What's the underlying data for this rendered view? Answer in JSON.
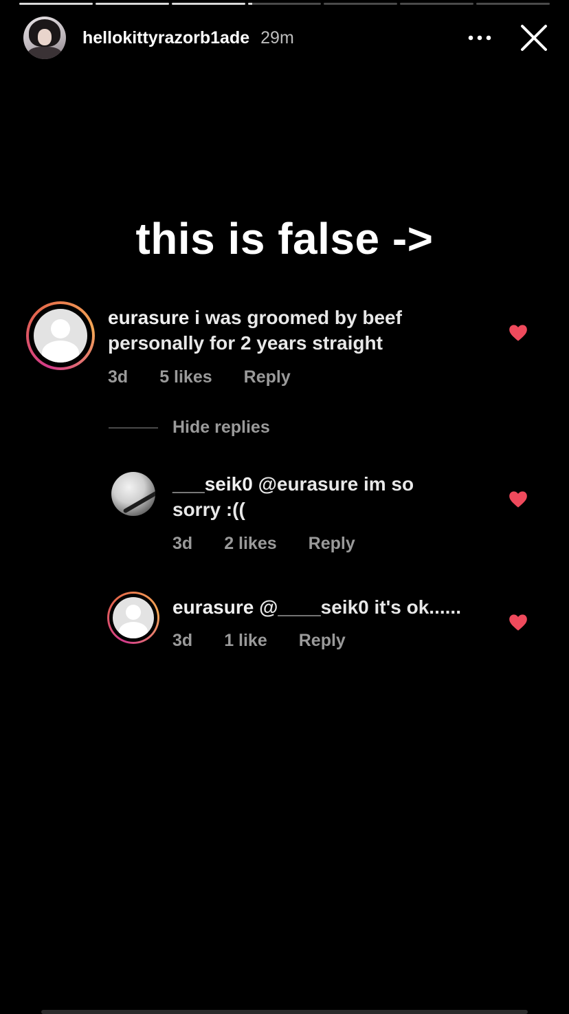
{
  "story": {
    "username": "hellokittyrazorb1ade",
    "time": "29m",
    "headline": "this is false ->",
    "progress": {
      "segments": 7,
      "completed": 3,
      "active_index": 3
    }
  },
  "comments": [
    {
      "user": "eurasure",
      "text": " i was groomed by beef personally for 2 years straight",
      "age": "3d",
      "likes": "5 likes",
      "reply": "Reply",
      "liked": true
    },
    {
      "user": "___seik0",
      "text": " @eurasure im so sorry :((",
      "age": "3d",
      "likes": "2 likes",
      "reply": "Reply",
      "liked": true
    },
    {
      "user": "eurasure",
      "text": " @____seik0 it's ok......",
      "age": "3d",
      "likes": "1 like",
      "reply": "Reply",
      "liked": true
    }
  ],
  "hide_replies": "Hide replies",
  "colors": {
    "heart": "#ef4a5c",
    "meta": "#9a9a9a",
    "ring_start": "#d23b8a",
    "ring_end": "#f4a857"
  }
}
